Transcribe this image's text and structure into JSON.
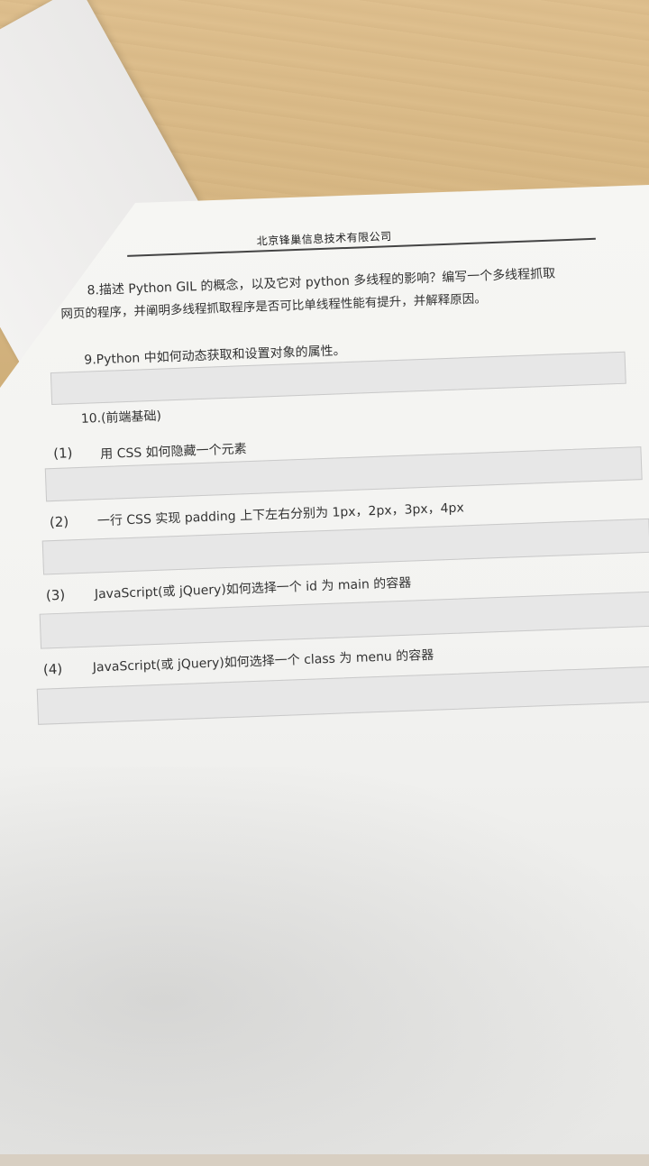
{
  "header": {
    "company": "北京锋巢信息技术有限公司"
  },
  "questions": {
    "q8": {
      "line1": "8.描述 Python GIL 的概念，以及它对 python 多线程的影响？编写一个多线程抓取",
      "line2": "网页的程序，并阐明多线程抓取程序是否可比单线程性能有提升，并解释原因。"
    },
    "q9": {
      "text": "9.Python 中如何动态获取和设置对象的属性。"
    },
    "q10": {
      "title": "10.(前端基础)",
      "items": [
        {
          "num": "(1)",
          "text": "用 CSS 如何隐藏一个元素"
        },
        {
          "num": "(2)",
          "text": "一行 CSS 实现 padding 上下左右分别为 1px，2px，3px，4px"
        },
        {
          "num": "(3)",
          "text": "JavaScript(或 jQuery)如何选择一个 id 为 main 的容器"
        },
        {
          "num": "(4)",
          "text": "JavaScript(或 jQuery)如何选择一个 class 为 menu 的容器"
        }
      ]
    }
  },
  "colors": {
    "desk": "#d6b682",
    "paper": "#f5f5f3",
    "answer_box": "#e7e7e7",
    "text": "#333333"
  }
}
